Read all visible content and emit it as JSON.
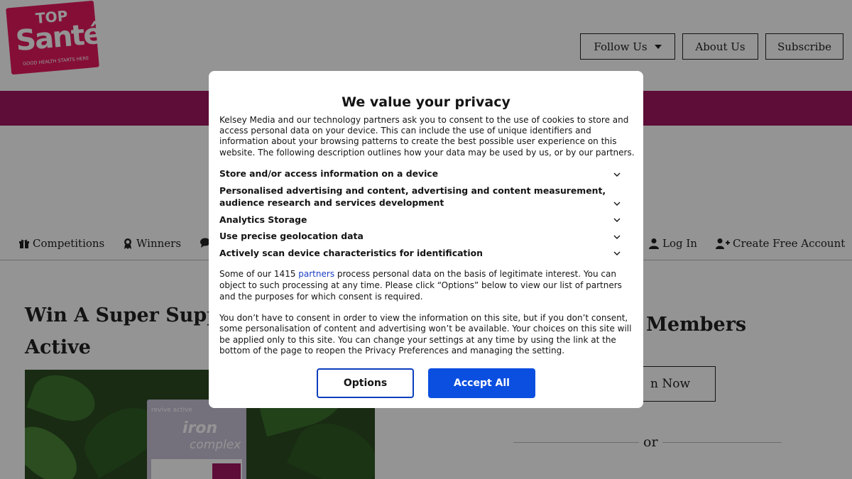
{
  "header": {
    "logo": {
      "line1": "TOP",
      "line2": "Santé",
      "tagline": "GOOD HEALTH STARTS HERE"
    },
    "buttons": {
      "follow_us": "Follow Us",
      "about_us": "About Us",
      "subscribe": "Subscribe"
    }
  },
  "nav": {
    "competitions": "Competitions",
    "winners": "Winners",
    "log_in": "Log In",
    "create_account": "Create Free Account"
  },
  "article": {
    "title": "Win A Super Supple Active",
    "title_line1": "Win A Super Supple",
    "title_line2": "Active",
    "image_brand": "revive active",
    "image_product": "iron",
    "image_product_sub": "complex"
  },
  "sidebar": {
    "members_heading": "Members",
    "join_button": "n Now",
    "or_text": "or"
  },
  "modal": {
    "title": "We value your privacy",
    "intro": "Kelsey Media and our technology partners ask you to consent to the use of cookies to store and access personal data on your device. This can include the use of unique identifiers and information about your browsing patterns to create the best possible user experience on this website. The following description outlines how your data may be used by us, or by our partners.",
    "purposes": [
      "Store and/or access information on a device",
      "Personalised advertising and content, advertising and content measurement, audience research and services development",
      "Analytics Storage",
      "Use precise geolocation data",
      "Actively scan device characteristics for identification"
    ],
    "legit_prefix": "Some of our 1415 ",
    "legit_link": "partners",
    "legit_suffix": " process personal data on the basis of legitimate interest. You can object to such processing at any time. Please click “Options” below to view our list of partners and the purposes for which consent is required.",
    "consent_text": "You don’t have to consent in order to view the information on this site, but if you don’t consent, some personalisation of content and advertising won’t be available. Your choices on this site will be applied only to this site. You can change your settings at any time by using the link at the bottom of the page to reopen the Privacy Preferences and managing the setting.",
    "options_button": "Options",
    "accept_button": "Accept All"
  },
  "colors": {
    "brand_pink": "#e6195f",
    "band": "#a0185f",
    "accept_blue": "#0b4fe0",
    "link_blue": "#1a3ec4"
  }
}
